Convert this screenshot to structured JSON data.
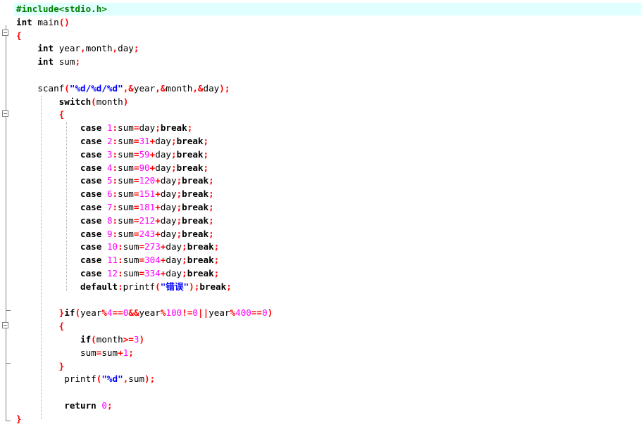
{
  "code_lines": [
    "#include<stdio.h>",
    "int main()",
    "{",
    "    int year,month,day;",
    "    int sum;",
    "",
    "    scanf(\"%d/%d/%d\",&year,&month,&day);",
    "        switch(month)",
    "        {",
    "            case 1:sum=day;break;",
    "            case 2:sum=31+day;break;",
    "            case 3:sum=59+day;break;",
    "            case 4:sum=90+day;break;",
    "            case 5:sum=120+day;break;",
    "            case 6:sum=151+day;break;",
    "            case 7:sum=181+day;break;",
    "            case 8:sum=212+day;break;",
    "            case 9:sum=243+day;break;",
    "            case 10:sum=273+day;break;",
    "            case 11:sum=304+day;break;",
    "            case 12:sum=334+day;break;",
    "            default:printf(\"错误\");break;",
    "",
    "        }if(year%4==0&&year%100!=0||year%400==0)",
    "        {",
    "            if(month>=3)",
    "            sum=sum+1;",
    "        }",
    "         printf(\"%d\",sum);",
    "",
    "         return 0;",
    "}"
  ],
  "colors": {
    "keyword": "#000000",
    "number": "#ff00ff",
    "string": "#0000ff",
    "operator": "#ff0000",
    "preprocessor": "#008000",
    "current_line_bg": "#e0ffff"
  }
}
